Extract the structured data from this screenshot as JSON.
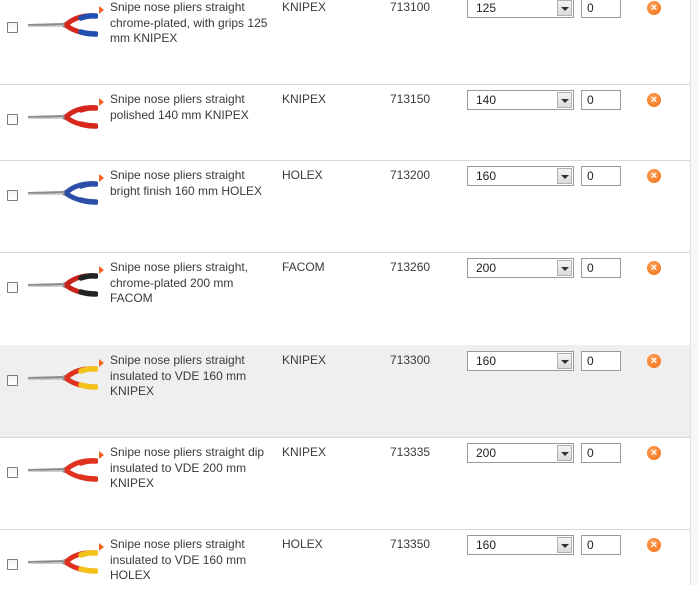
{
  "rows": [
    {
      "desc": "Snipe nose pliers straight chrome-plated, with grips 125 mm KNIPEX",
      "brand": "KNIPEX",
      "code": "713100",
      "size": "125",
      "qty": "0",
      "handle": "#d7261b",
      "grip": "#1f4fb0",
      "highlight": false
    },
    {
      "desc": "Snipe nose pliers straight polished 140 mm KNIPEX",
      "brand": "KNIPEX",
      "code": "713150",
      "size": "140",
      "qty": "0",
      "handle": "#d7261b",
      "grip": "#d7261b",
      "highlight": false
    },
    {
      "desc": "Snipe nose pliers straight bright finish 160 mm HOLEX",
      "brand": "HOLEX",
      "code": "713200",
      "size": "160",
      "qty": "0",
      "handle": "#2d4ea8",
      "grip": "#2d4ea8",
      "highlight": false
    },
    {
      "desc": "Snipe nose pliers straight, chrome-plated 200 mm FACOM",
      "brand": "FACOM",
      "code": "713260",
      "size": "200",
      "qty": "0",
      "handle": "#c8241b",
      "grip": "#222222",
      "highlight": false
    },
    {
      "desc": "Snipe nose pliers straight insulated to VDE 160 mm KNIPEX",
      "brand": "KNIPEX",
      "code": "713300",
      "size": "160",
      "qty": "0",
      "handle": "#e0301e",
      "grip": "#f2c21a",
      "highlight": true
    },
    {
      "desc": "Snipe nose pliers straight dip insulated to VDE 200 mm KNIPEX",
      "brand": "KNIPEX",
      "code": "713335",
      "size": "200",
      "qty": "0",
      "handle": "#e0301e",
      "grip": "#e0301e",
      "highlight": false
    },
    {
      "desc": "Snipe nose pliers straight insulated to VDE 160 mm HOLEX",
      "brand": "HOLEX",
      "code": "713350",
      "size": "160",
      "qty": "0",
      "handle": "#e0301e",
      "grip": "#f2c21a",
      "highlight": false
    }
  ],
  "icons": {
    "checkbox": "checkbox-icon",
    "product": "pliers-icon",
    "bullet": "bullet-arrow-icon",
    "dropdown": "chevron-down-icon",
    "remove": "close-icon"
  },
  "colors": {
    "accent": "#f26522",
    "remove": "#f06b12"
  }
}
